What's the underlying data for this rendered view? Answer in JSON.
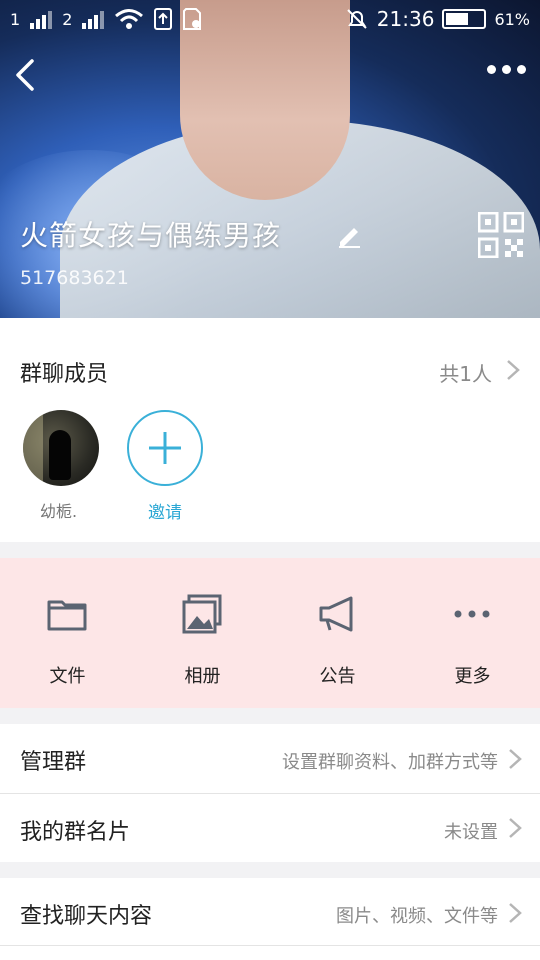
{
  "status_bar": {
    "sim1": "1",
    "sim2": "2",
    "time": "21:36",
    "battery": "61%",
    "battery_level": 0.61
  },
  "header": {
    "group_name": "火箭女孩与偶练男孩",
    "group_id": "517683621"
  },
  "members": {
    "title": "群聊成员",
    "count": "共1人",
    "list": [
      {
        "name": "幼栀."
      }
    ],
    "invite_label": "邀请"
  },
  "actions": [
    {
      "label": "文件",
      "icon": "folder-icon"
    },
    {
      "label": "相册",
      "icon": "photo-album-icon"
    },
    {
      "label": "公告",
      "icon": "megaphone-icon"
    },
    {
      "label": "更多",
      "icon": "more-dots-icon"
    }
  ],
  "rows": [
    {
      "title": "管理群",
      "value": "设置群聊资料、加群方式等"
    },
    {
      "title": "我的群名片",
      "value": "未设置"
    },
    {
      "title": "查找聊天内容",
      "value": "图片、视频、文件等"
    }
  ],
  "colors": {
    "accent": "#2aa7d4",
    "actions_bg": "#fde6e7",
    "icon_gray": "#5b6472"
  }
}
